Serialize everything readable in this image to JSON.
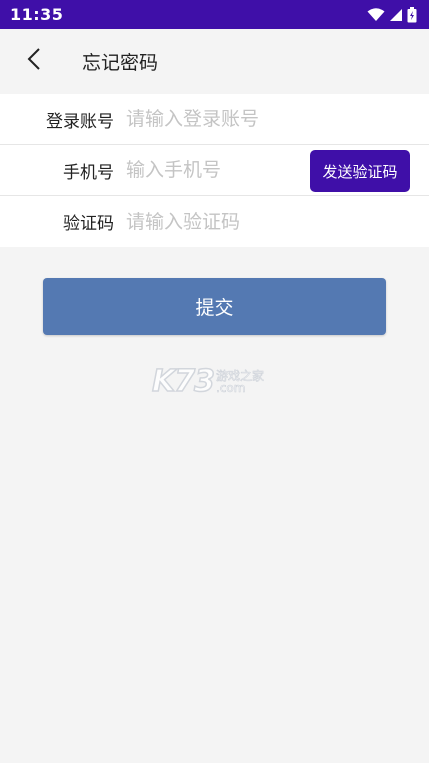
{
  "status_bar": {
    "time": "11:35",
    "icons": [
      "wifi-icon",
      "signal-icon",
      "battery-icon"
    ],
    "color": "#3f0fa8"
  },
  "app_bar": {
    "back_icon": "chevron-left-icon",
    "title": "忘记密码"
  },
  "form": {
    "account": {
      "label": "登录账号",
      "placeholder": "请输入登录账号",
      "value": ""
    },
    "phone": {
      "label": "手机号",
      "placeholder": "输入手机号",
      "value": "",
      "send_code_label": "发送验证码"
    },
    "code": {
      "label": "验证码",
      "placeholder": "请输入验证码",
      "value": ""
    }
  },
  "submit": {
    "label": "提交",
    "color": "#5479b2"
  },
  "watermark": {
    "logo": "K73",
    "tagline": "游戏之家",
    "domain": ".com"
  },
  "colors": {
    "accent": "#3f0fa8",
    "background": "#f4f4f4"
  }
}
